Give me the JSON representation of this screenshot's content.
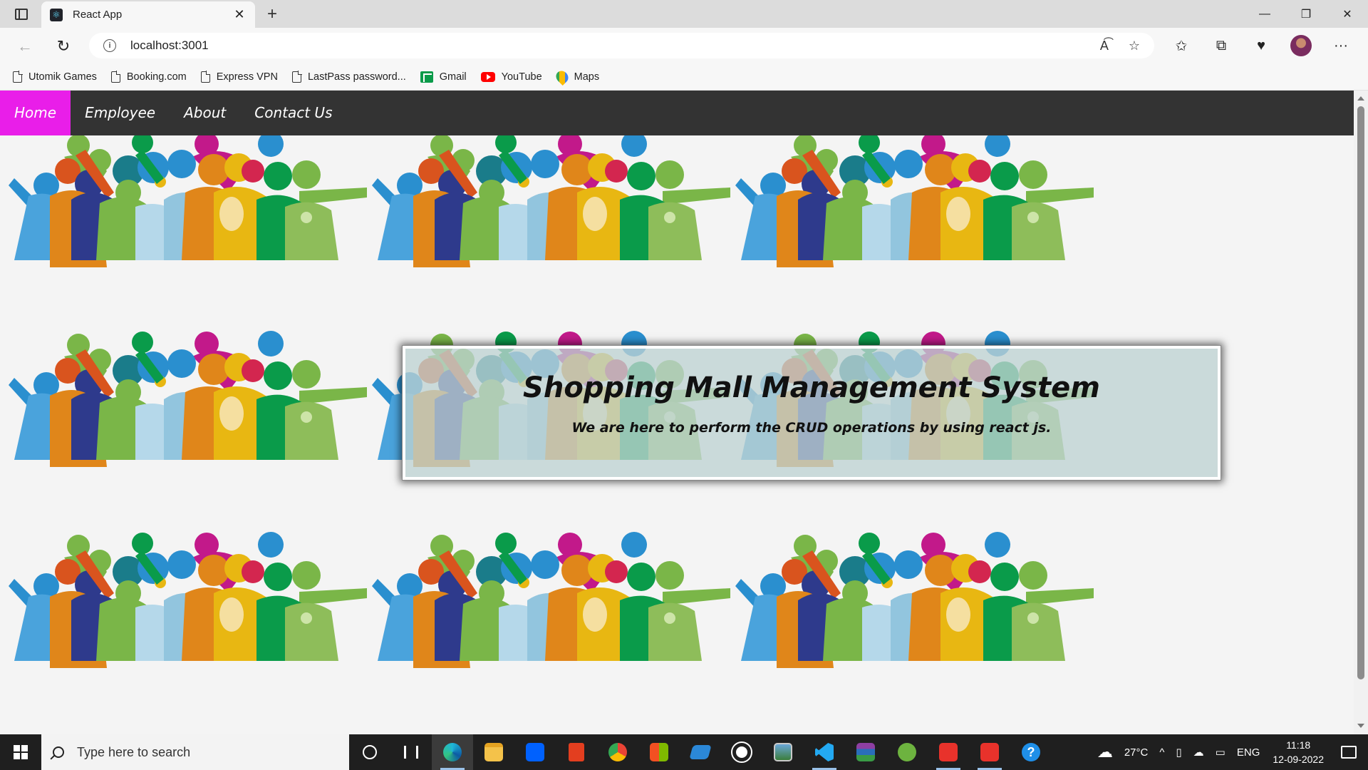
{
  "browser": {
    "tab_title": "React App",
    "tab_favicon": "react-icon",
    "url": "localhost:3001",
    "new_tab_label": "+",
    "close_tab_label": "✕"
  },
  "bookmarks": [
    {
      "label": "Utomik Games",
      "icon": "page-icon"
    },
    {
      "label": "Booking.com",
      "icon": "page-icon"
    },
    {
      "label": "Express VPN",
      "icon": "page-icon"
    },
    {
      "label": "LastPass password...",
      "icon": "page-icon"
    },
    {
      "label": "Gmail",
      "icon": "gmail-icon"
    },
    {
      "label": "YouTube",
      "icon": "youtube-icon"
    },
    {
      "label": "Maps",
      "icon": "maps-icon"
    }
  ],
  "nav": {
    "items": [
      {
        "label": "Home",
        "active": true
      },
      {
        "label": "Employee",
        "active": false
      },
      {
        "label": "About",
        "active": false
      },
      {
        "label": "Contact Us",
        "active": false
      }
    ],
    "active_color": "#e91ee9",
    "bar_color": "#333333"
  },
  "hero": {
    "title": "Shopping Mall Management System",
    "subtitle": "We are here to perform the CRUD operations by using react js."
  },
  "taskbar": {
    "search_placeholder": "Type here to search",
    "weather": "27°C",
    "language": "ENG",
    "time": "11:18",
    "date": "12-09-2022"
  }
}
